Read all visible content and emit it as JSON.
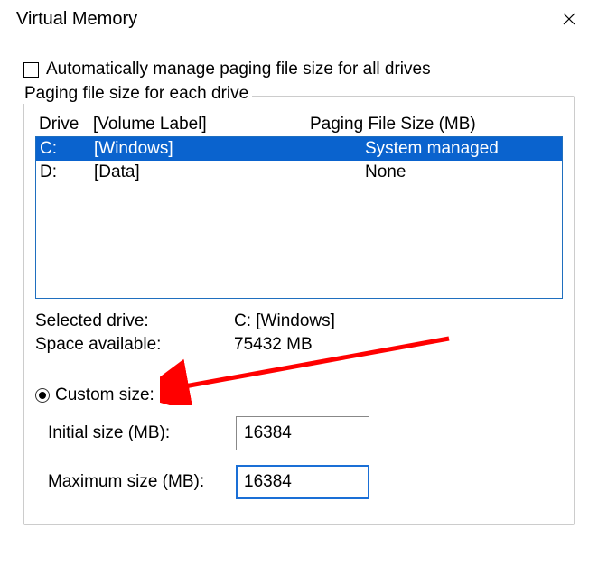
{
  "title": "Virtual Memory",
  "auto_manage": {
    "label": "Automatically manage paging file size for all drives",
    "checked": false
  },
  "group": {
    "caption": "Paging file size for each drive",
    "headers": {
      "drive": "Drive",
      "label": "[Volume Label]",
      "size": "Paging File Size (MB)"
    },
    "drives": [
      {
        "drive": "C:",
        "label": "[Windows]",
        "size": "System managed",
        "selected": true
      },
      {
        "drive": "D:",
        "label": "[Data]",
        "size": "None",
        "selected": false
      }
    ],
    "selected": {
      "label": "Selected drive:",
      "value": "C:  [Windows]"
    },
    "space": {
      "label": "Space available:",
      "value": "75432 MB"
    },
    "custom_radio": {
      "label": "Custom size:",
      "checked": true
    },
    "initial": {
      "label": "Initial size (MB):",
      "value": "16384"
    },
    "maximum": {
      "label": "Maximum size (MB):",
      "value": "16384"
    }
  }
}
